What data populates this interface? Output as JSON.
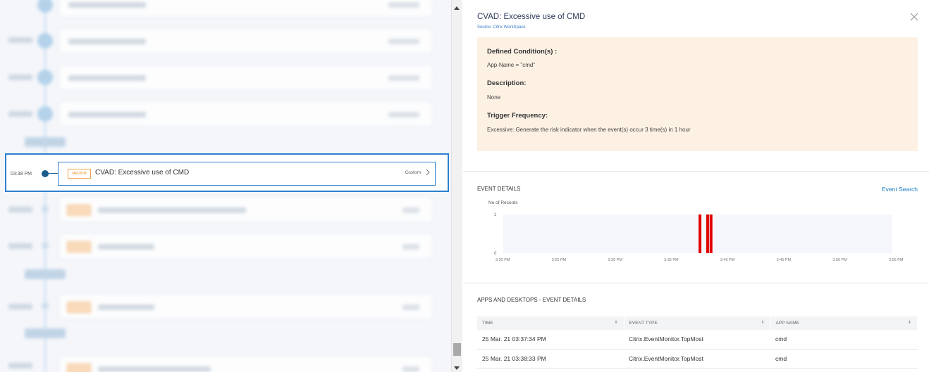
{
  "timeline": {
    "selected": {
      "time": "03:38 PM",
      "badge": "MEDIUM",
      "title": "CVAD: Excessive use of CMD",
      "type": "Custom"
    }
  },
  "panel": {
    "title": "CVAD: Excessive use of CMD",
    "source": "Source: Citrix WorkSpace",
    "close_icon": "close-icon",
    "conditions": {
      "defined_label": "Defined Condition(s) :",
      "defined_value": "App-Name = \"cmd\"",
      "description_label": "Description:",
      "description_value": "None",
      "trigger_label": "Trigger Frequency:",
      "trigger_value": "Excessive:  Generate the risk indicator when the event(s) occur 3 time(s) in 1 hour"
    },
    "event_details": {
      "title": "EVENT DETAILS",
      "search_link": "Event Search"
    },
    "apps": {
      "title": "APPS AND DESKTOPS - EVENT DETAILS",
      "columns": [
        "TIME",
        "EVENT TYPE",
        "APP NAME"
      ],
      "rows": [
        [
          "25 Mar. 21 03:37:34 PM",
          "Citrix.EventMonitor.TopMost",
          "cmd"
        ],
        [
          "25 Mar. 21 03:38:33 PM",
          "Citrix.EventMonitor.TopMost",
          "cmd"
        ]
      ]
    }
  },
  "chart_data": {
    "type": "bar",
    "ylabel": "No of Records",
    "ylim": [
      0,
      1
    ],
    "yticks": [
      "0",
      "1"
    ],
    "xticks": [
      "3:20 PM",
      "3:25 PM",
      "3:30 PM",
      "3:35 PM",
      "3:40 PM",
      "3:45 PM",
      "3:50 PM",
      "3:55 PM"
    ],
    "x_range_minutes": [
      0,
      35
    ],
    "bars": [
      {
        "x": "3:37:34 PM",
        "value": 1
      },
      {
        "x": "3:38:15 PM",
        "value": 1
      },
      {
        "x": "3:38:33 PM",
        "value": 1
      }
    ],
    "bar_color": "#e00000",
    "grid": false
  },
  "colors": {
    "accent": "#2d7fd0",
    "badge_medium": "#f08c1f",
    "condition_bg": "#fdf1e4",
    "link": "#1b7cc1"
  }
}
